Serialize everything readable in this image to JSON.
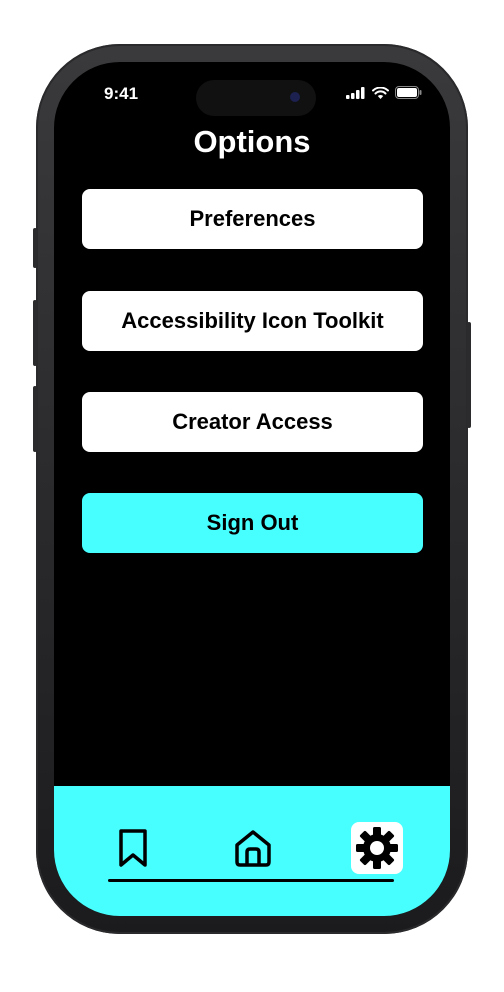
{
  "status_bar": {
    "time": "9:41",
    "icons": [
      "signal-icon",
      "wifi-icon",
      "battery-icon"
    ]
  },
  "page": {
    "title": "Options"
  },
  "menu": {
    "preferences_label": "Preferences",
    "accessibility_label": "Accessibility Icon Toolkit",
    "creator_access_label": "Creator Access",
    "sign_out_label": "Sign Out"
  },
  "tab_bar": {
    "tabs": [
      {
        "icon": "bookmark-icon",
        "active": false
      },
      {
        "icon": "home-icon",
        "active": false
      },
      {
        "icon": "gear-icon",
        "active": true
      }
    ]
  },
  "colors": {
    "accent": "#48FFFF",
    "background": "#000000",
    "button": "#FFFFFF"
  }
}
